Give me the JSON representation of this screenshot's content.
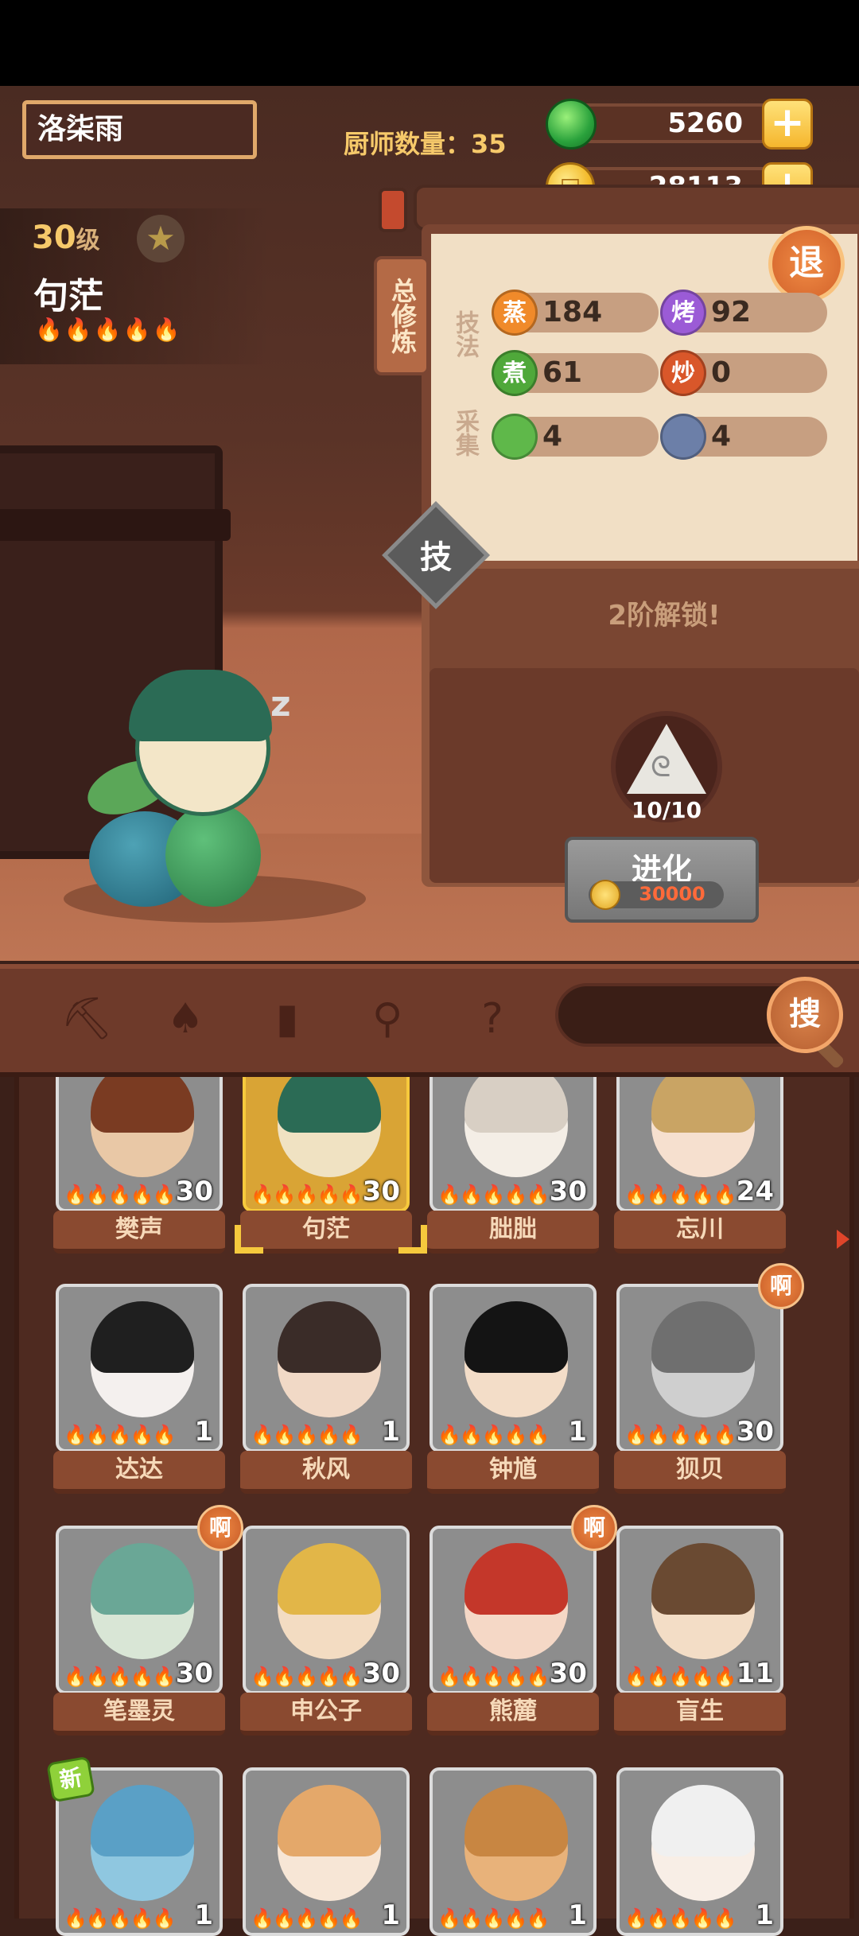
{
  "header": {
    "player_name": "洛柒雨",
    "chef_count_label": "厨师数量：35",
    "jade_amount": "5260",
    "coin_amount": "28113",
    "plus_label": "+",
    "coin_glyph": "□"
  },
  "profile": {
    "level": "30",
    "level_unit": "级",
    "star": "★",
    "chef_name": "句茫",
    "flames": "🔥🔥🔥🔥🔥"
  },
  "panel": {
    "tab_label": "总修炼",
    "quit_label": "退",
    "technique_label": "技法",
    "gather_label": "采集",
    "stats": [
      {
        "icon": "蒸",
        "value": "184",
        "color": "#f08a2a"
      },
      {
        "icon": "烤",
        "value": "92",
        "color": "#9b5bd6"
      },
      {
        "icon": "煮",
        "value": "61",
        "color": "#4fa83a"
      },
      {
        "icon": "炒",
        "value": "0",
        "color": "#d9572a"
      },
      {
        "icon": "菜",
        "value": "4",
        "color": "#5fb84a"
      },
      {
        "icon": "鱼",
        "value": "4",
        "color": "#6c7fa8"
      }
    ],
    "skill_label": "技",
    "unlock_text": "2阶解锁!",
    "evolve_count": "10/10",
    "evolve_label": "进化",
    "evolve_cost": "30000"
  },
  "toolbar": {
    "search_label": "搜"
  },
  "roster": [
    {
      "name": "樊声",
      "level": "30",
      "flames": "🔥🔥🔥🔥🔥",
      "face": "#e9c8a6",
      "hair": "#7a3b22"
    },
    {
      "name": "句茫",
      "level": "30",
      "flames": "🔥🔥🔥🔥🔥",
      "face": "#f0e2c2",
      "hair": "#2b6b55",
      "selected": true
    },
    {
      "name": "朏朏",
      "level": "30",
      "flames": "🔥🔥🔥🔥🔥",
      "face": "#f4eee6",
      "hair": "#d8cfc4"
    },
    {
      "name": "忘川",
      "level": "24",
      "flames": "🔥🔥🔥🔥🔥",
      "face": "#f6e0cf",
      "hair": "#c9a464"
    },
    {
      "name": "达达",
      "level": "1",
      "flames": "🔥🔥🔥🔥🔥",
      "face": "#f4f0ee",
      "hair": "#1f1f1f"
    },
    {
      "name": "秋风",
      "level": "1",
      "flames": "🔥🔥🔥🔥🔥",
      "face": "#f1d9c6",
      "hair": "#3a2c28"
    },
    {
      "name": "钟馗",
      "level": "1",
      "flames": "🔥🔥🔥🔥🔥",
      "face": "#f3ddc8",
      "hair": "#141414"
    },
    {
      "name": "狈贝",
      "level": "30",
      "flames": "🔥🔥🔥🔥🔥",
      "face": "#cfcfcf",
      "hair": "#6f6f6f",
      "badge": "啊"
    },
    {
      "name": "笔墨灵",
      "level": "30",
      "flames": "🔥🔥🔥🔥🔥",
      "face": "#d9e6d6",
      "hair": "#6aa796",
      "badge": "啊"
    },
    {
      "name": "申公子",
      "level": "30",
      "flames": "🔥🔥🔥🔥🔥",
      "face": "#f3dcc2",
      "hair": "#e2b648"
    },
    {
      "name": "熊麓",
      "level": "30",
      "flames": "🔥🔥🔥🔥🔥",
      "face": "#f5d8c6",
      "hair": "#c4372a",
      "badge": "啊"
    },
    {
      "name": "盲生",
      "level": "11",
      "flames": "🔥🔥🔥🔥🔥",
      "face": "#f3ddc6",
      "hair": "#6a4a32"
    },
    {
      "name": "",
      "level": "1",
      "flames": "🔥🔥🔥🔥🔥",
      "face": "#8fc7e0",
      "hair": "#5aa0c6",
      "new": "新"
    },
    {
      "name": "",
      "level": "1",
      "flames": "🔥🔥🔥🔥🔥",
      "face": "#f7e6d6",
      "hair": "#e4a86a"
    },
    {
      "name": "",
      "level": "1",
      "flames": "🔥🔥🔥🔥🔥",
      "face": "#e8b27a",
      "hair": "#c88642"
    },
    {
      "name": "",
      "level": "1",
      "flames": "🔥🔥🔥🔥🔥",
      "face": "#f8eee6",
      "hair": "#f0f0f0"
    }
  ],
  "icons": {
    "toolbar_icons": [
      "shovel-icon",
      "spade-icon",
      "jar-icon",
      "location-icon",
      "map-question-icon"
    ]
  }
}
